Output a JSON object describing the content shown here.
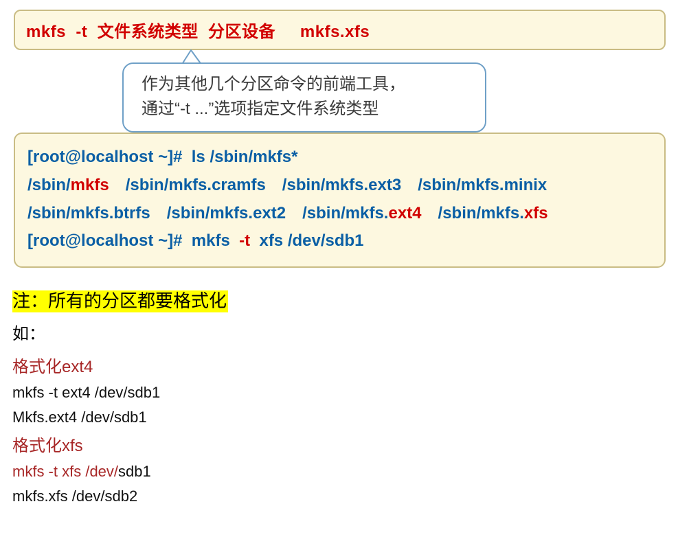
{
  "syntax": {
    "cmd": "mkfs",
    "opt": "-t",
    "arg1": "文件系统类型",
    "arg2": "分区设备",
    "alt": "mkfs.xfs"
  },
  "callout": {
    "line1": "作为其他几个分区命令的前端工具，",
    "line2": "通过“-t ...”选项指定文件系统类型"
  },
  "terminal": {
    "prompt": "[root@localhost ~]#",
    "ls_cmd": "ls  /sbin/mkfs*",
    "row1": {
      "c1a": "/sbin/",
      "c1b": "mkfs",
      "c2": "/sbin/mkfs.cramfs",
      "c3": "/sbin/mkfs.ext3",
      "c4": "/sbin/mkfs.minix"
    },
    "row2": {
      "c1": "/sbin/mkfs.btrfs",
      "c2": "/sbin/mkfs.ext2",
      "c3a": "/sbin/mkfs.",
      "c3b": "ext4",
      "c4a": "/sbin/mkfs.",
      "c4b": "xfs"
    },
    "mkfs_cmd_a": "mkfs",
    "mkfs_cmd_b": "-t",
    "mkfs_cmd_c": "xfs /dev/sdb1"
  },
  "notes": {
    "highlight": "注：所有的分区都要格式化",
    "ru": "如：",
    "ext4_head": "格式化ext4",
    "ext4_cmd1": "mkfs -t ext4 /dev/sdb1",
    "ext4_cmd2": "Mkfs.ext4 /dev/sdb1",
    "xfs_head": "格式化xfs",
    "xfs_cmd1_red": "mkfs -t xfs /dev/",
    "xfs_cmd1_rest": "sdb1",
    "xfs_cmd2": "mkfs.xfs /dev/sdb2"
  }
}
